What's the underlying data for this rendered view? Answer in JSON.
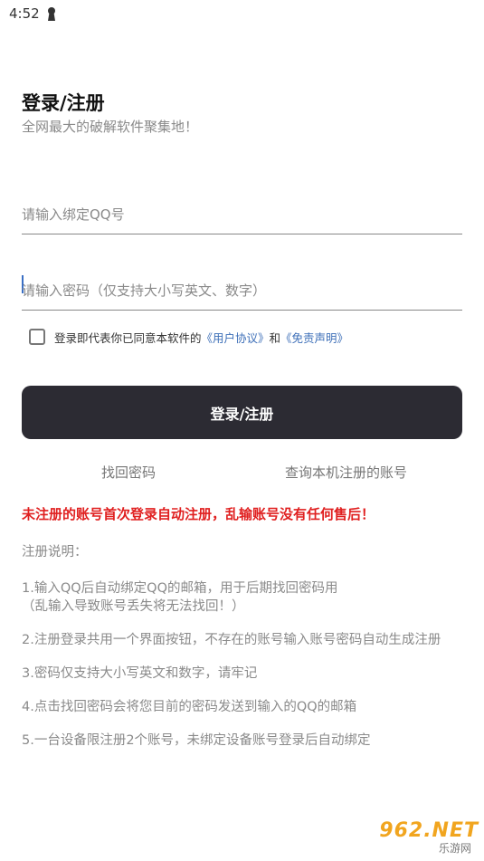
{
  "status_bar": {
    "time": "4:52",
    "icon": "keyhole-icon"
  },
  "header": {
    "title": "登录/注册",
    "subtitle": "全网最大的破解软件聚集地！"
  },
  "form": {
    "account_placeholder": "请输入绑定QQ号",
    "account_value": "",
    "password_placeholder": "请输入密码（仅支持大小写英文、数字）",
    "password_value": ""
  },
  "agreement": {
    "checked": false,
    "prefix": "登录即代表你已同意本软件的",
    "user_agreement": "《用户协议》",
    "and": "和",
    "disclaimer": "《免责声明》"
  },
  "actions": {
    "login_label": "登录/注册",
    "forgot_label": "找回密码",
    "query_label": "查询本机注册的账号"
  },
  "warning": "未注册的账号首次登录自动注册，乱输账号没有任何售后！",
  "notes": {
    "heading": "注册说明：",
    "items": [
      "1.输入QQ后自动绑定QQ的邮箱，用于后期找回密码用\n（乱输入导致账号丢失将无法找回！）",
      "2.注册登录共用一个界面按钮，不存在的账号输入账号密码自动生成注册",
      "3.密码仅支持大小写英文和数字，请牢记",
      "4.点击找回密码会将您目前的密码发送到输入的QQ的邮箱",
      "5.一台设备限注册2个账号，未绑定设备账号登录后自动绑定"
    ]
  },
  "watermark": {
    "main": "962.NET",
    "sub": "乐游网"
  },
  "colors": {
    "button_bg": "#2c2b33",
    "link": "#3d6fb8",
    "warning": "#e02020",
    "watermark": "#f1a51f"
  }
}
